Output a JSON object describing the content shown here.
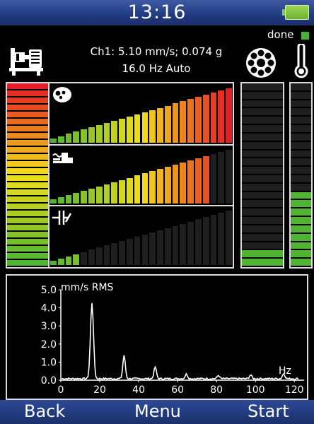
{
  "status_bar": {
    "time": "13:16"
  },
  "status": {
    "done_label": "done"
  },
  "readout": {
    "line1": "Ch1: 5.10 mm/s; 0.074 g",
    "line2": "16.0 Hz Auto"
  },
  "meters": {
    "overall_level": 0.0,
    "bearing_level": 0.1,
    "temperature_level": 0.4,
    "rows": [
      {
        "icon": "vibration-sensor-icon",
        "lit_bars": 24,
        "total_bars": 24
      },
      {
        "icon": "machine-mount-icon",
        "lit_bars": 21,
        "total_bars": 24
      },
      {
        "icon": "coupling-icon",
        "lit_bars": 4,
        "total_bars": 24
      }
    ]
  },
  "chart_data": {
    "type": "line",
    "ylabel": "mm/s RMS",
    "xlabel": "Hz",
    "xlim": [
      0,
      125
    ],
    "ylim": [
      0,
      5.0
    ],
    "x_ticks": [
      "0",
      "20",
      "40",
      "60",
      "80",
      "100",
      "120"
    ],
    "y_ticks": [
      "0.0",
      "1.0",
      "2.0",
      "3.0",
      "4.0",
      "5.0"
    ],
    "peaks": [
      {
        "x": 16.0,
        "y": 4.2
      },
      {
        "x": 32.5,
        "y": 1.3
      },
      {
        "x": 48.5,
        "y": 0.65
      },
      {
        "x": 64.5,
        "y": 0.25
      },
      {
        "x": 81.0,
        "y": 0.18
      },
      {
        "x": 97.5,
        "y": 0.2
      },
      {
        "x": 114.5,
        "y": 0.28
      }
    ],
    "line_color": "#ffffff"
  },
  "nav": {
    "back": "Back",
    "menu": "Menu",
    "start": "Start"
  },
  "colors": {
    "low": "#4fb531",
    "mid": "#f3df1a",
    "high": "#e31e25",
    "off": "#1f1f1f",
    "bar_blue": "#213a80"
  }
}
